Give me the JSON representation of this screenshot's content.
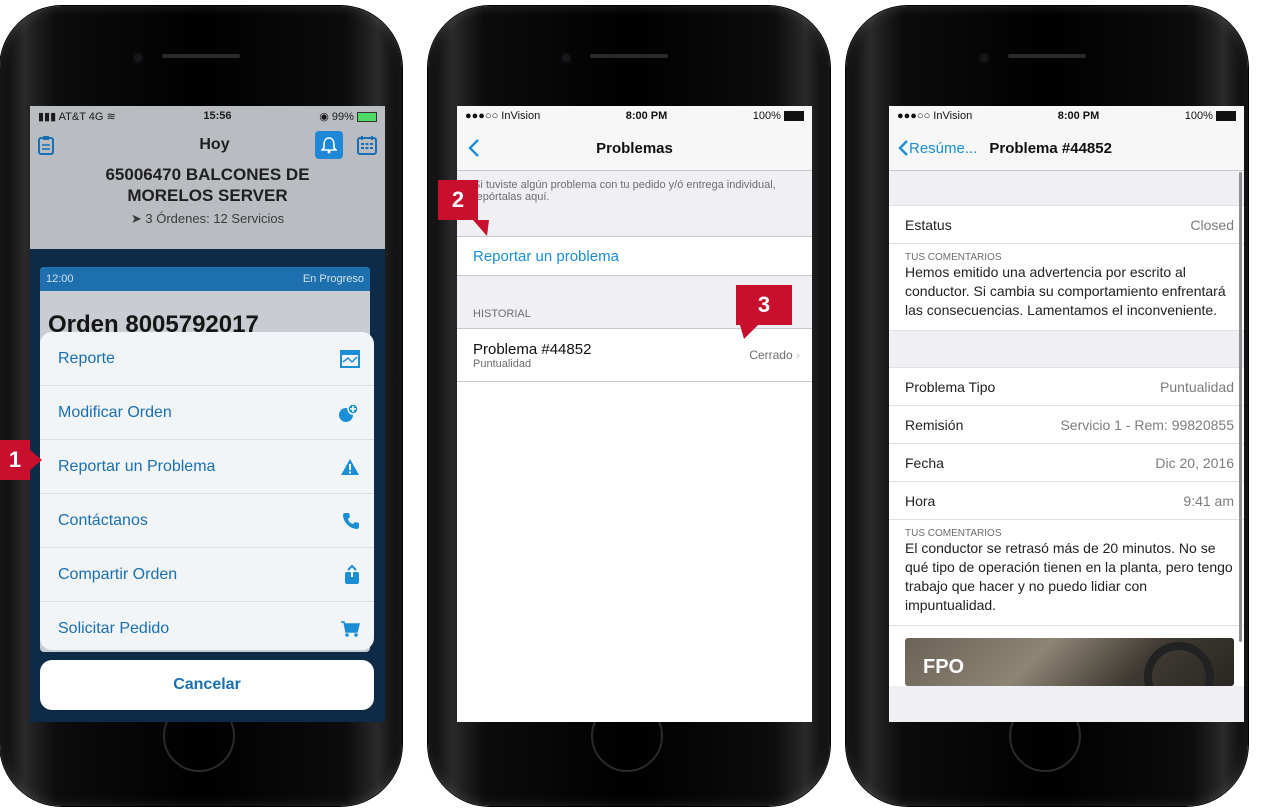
{
  "screen1": {
    "status": {
      "carrier": "AT&T 4G",
      "time": "15:56",
      "battery": "99%"
    },
    "nav": {
      "title": "Hoy"
    },
    "customer": {
      "line1": "65006470 BALCONES DE",
      "line2": "MORELOS SERVER"
    },
    "orders_summary": "3 Órdenes: 12 Servicios",
    "order_card": {
      "time": "12:00",
      "status": "En Progreso",
      "title": "Orden 8005792017"
    },
    "action_sheet": {
      "items": [
        {
          "label": "Reporte",
          "icon": "report-icon"
        },
        {
          "label": "Modificar Orden",
          "icon": "modify-order-icon"
        },
        {
          "label": "Reportar un Problema",
          "icon": "warning-icon"
        },
        {
          "label": "Contáctanos",
          "icon": "phone-icon"
        },
        {
          "label": "Compartir Orden",
          "icon": "share-icon"
        },
        {
          "label": "Solicitar Pedido",
          "icon": "cart-icon"
        }
      ],
      "cancel": "Cancelar"
    }
  },
  "screen2": {
    "status": {
      "carrier": "●●●○○ InVision",
      "time": "8:00 PM",
      "battery": "100%"
    },
    "nav": {
      "title": "Problemas"
    },
    "note": "Si tuviste algún problema con tu pedido y/ó entrega individual, repórtalas aquí.",
    "report_link": "Reportar un problema",
    "section_header": "HISTORIAL",
    "history": [
      {
        "title": "Problema #44852",
        "subtitle": "Puntualidad",
        "status": "Cerrado"
      }
    ]
  },
  "screen3": {
    "status": {
      "carrier": "●●●○○ InVision",
      "time": "8:00 PM",
      "battery": "100%"
    },
    "nav": {
      "back": "Resúme...",
      "title": "Problema #44852"
    },
    "estatus": {
      "label": "Estatus",
      "value": "Closed"
    },
    "comment1": {
      "label": "TUS COMENTARIOS",
      "text": "Hemos emitido una advertencia por escrito al conductor. Si cambia su comportamiento enfrentará las consecuencias. Lamentamos el inconveniente."
    },
    "details": [
      {
        "label": "Problema Tipo",
        "value": "Puntualidad"
      },
      {
        "label": "Remisión",
        "value": "Servicio 1 - Rem: 99820855"
      },
      {
        "label": "Fecha",
        "value": "Dic 20, 2016"
      },
      {
        "label": "Hora",
        "value": "9:41 am"
      }
    ],
    "comment2": {
      "label": "TUS COMENTARIOS",
      "text": "El conductor se retrasó más de 20 minutos. No se qué tipo de operación tienen en la planta, pero tengo trabajo que hacer y no puedo lidiar con impuntualidad."
    },
    "image_label": "FPO"
  },
  "steps": [
    "1",
    "2",
    "3"
  ],
  "colors": {
    "accent": "#1a6fb3",
    "badge": "#c8102e",
    "link": "#1a8fd8"
  }
}
